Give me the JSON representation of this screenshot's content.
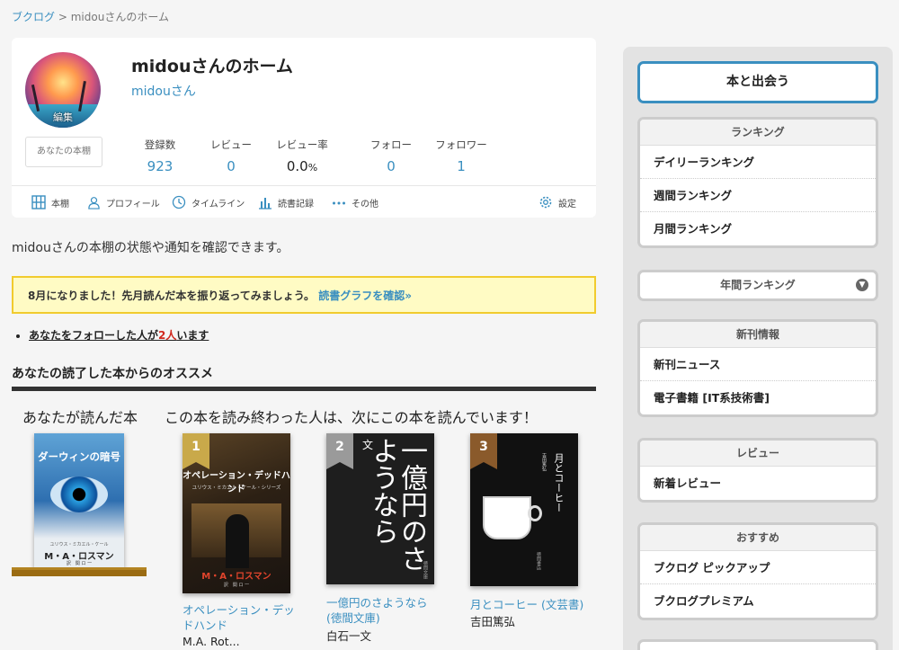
{
  "breadcrumb": {
    "root": "ブクログ",
    "sep": ">",
    "current": "midouさんのホーム"
  },
  "profile": {
    "title": "midouさんのホーム",
    "username": "midouさん",
    "avatar_edit": "編集",
    "shelf_button": "あなたの本棚",
    "stats": [
      {
        "label": "登録数",
        "value": "923"
      },
      {
        "label": "レビュー",
        "value": "0"
      },
      {
        "label": "レビュー率",
        "value": "0.0",
        "unit": "%"
      },
      {
        "label": "フォロー",
        "value": "0"
      },
      {
        "label": "フォロワー",
        "value": "1"
      }
    ],
    "tabs": {
      "shelf": "本棚",
      "profile": "プロフィール",
      "timeline": "タイムライン",
      "record": "読書記録",
      "other": "その他",
      "settings": "設定"
    }
  },
  "notice_text": "midouさんの本棚の状態や通知を確認できます。",
  "alert": {
    "text": "8月になりました！先月読んだ本を振り返ってみましょう。",
    "link": "読書グラフを確認»"
  },
  "follow_notice": {
    "pre": "あなたをフォローした人が",
    "count": "2人",
    "post": "います"
  },
  "recommend": {
    "section_title": "あなたの読了した本からのオススメ",
    "read_label": "あなたが読んだ本",
    "next_label": "この本を読み終わった人は、次にこの本を読んでいます！",
    "read_book": {
      "cover_title": "ダーウィンの暗号",
      "cover_author": "M・A・ロスマン",
      "cover_sub": "ユリウス・ミカエル・ケール",
      "cover_translator": "訳　関 ロ 一"
    },
    "items": [
      {
        "rank": "1",
        "title": "オペレーション・デッドハンド",
        "author": "M.A. Rot...",
        "cover_title": "オペレーション・デッドハンド",
        "cover_sub": "ユリウス・ミカエル・ケール・シリーズ",
        "cover_author": "M・A・ロスマン",
        "cover_translator": "訳　関 ロ 一"
      },
      {
        "rank": "2",
        "title": "一億円のさようなら (徳間文庫)",
        "author": "白石一文",
        "cover_title": "一億円のさようなら",
        "cover_prefix": "文",
        "cover_brand": "徳間文庫"
      },
      {
        "rank": "3",
        "title": "月とコーヒー (文芸書)",
        "author": "吉田篤弘",
        "cover_title": "月とコーヒー",
        "cover_author": "吉田篤弘",
        "cover_brand": "徳間書店"
      }
    ]
  },
  "sidebar": {
    "meet_button": "本と出会う",
    "ranking": {
      "head": "ランキング",
      "items": [
        "デイリーランキング",
        "週間ランキング",
        "月間ランキング"
      ]
    },
    "year_ranking": "年間ランキング",
    "new_releases": {
      "head": "新刊情報",
      "items": [
        "新刊ニュース",
        "電子書籍 [IT系技術書]"
      ]
    },
    "review": {
      "head": "レビュー",
      "items": [
        "新着レビュー"
      ]
    },
    "recommended": {
      "head": "おすすめ",
      "items": [
        "ブクログ ピックアップ",
        "ブクログプレミアム"
      ]
    }
  },
  "colors": {
    "link": "#3a8fc0",
    "alert_bg": "#fffbc4",
    "alert_border": "#f1cb2e",
    "rank_1": "#c9a94a",
    "rank_2": "#9a9a9a",
    "rank_3": "#8a5a2b"
  }
}
